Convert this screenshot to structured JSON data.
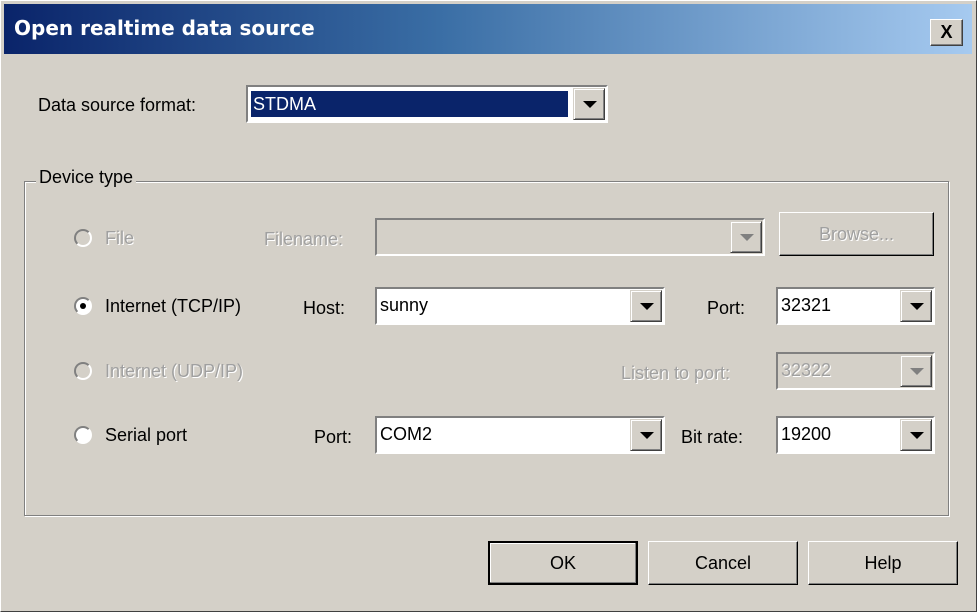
{
  "window": {
    "title": "Open realtime data source",
    "close_label": "X"
  },
  "format": {
    "label": "Data source format:",
    "value": "STDMA"
  },
  "device_group": {
    "label": "Device type"
  },
  "file": {
    "radio_label": "File",
    "selected": false,
    "enabled": false,
    "filename_label": "Filename:",
    "filename_value": "",
    "browse_label": "Browse..."
  },
  "tcp": {
    "radio_label": "Internet (TCP/IP)",
    "selected": true,
    "host_label": "Host:",
    "host_value": "sunny",
    "port_label": "Port:",
    "port_value": "32321"
  },
  "udp": {
    "radio_label": "Internet (UDP/IP)",
    "selected": false,
    "enabled": false,
    "listen_label": "Listen to port:",
    "listen_value": "32322"
  },
  "serial": {
    "radio_label": "Serial port",
    "selected": false,
    "port_label": "Port:",
    "port_value": "COM2",
    "bitrate_label": "Bit rate:",
    "bitrate_value": "19200"
  },
  "buttons": {
    "ok": "OK",
    "cancel": "Cancel",
    "help": "Help"
  }
}
